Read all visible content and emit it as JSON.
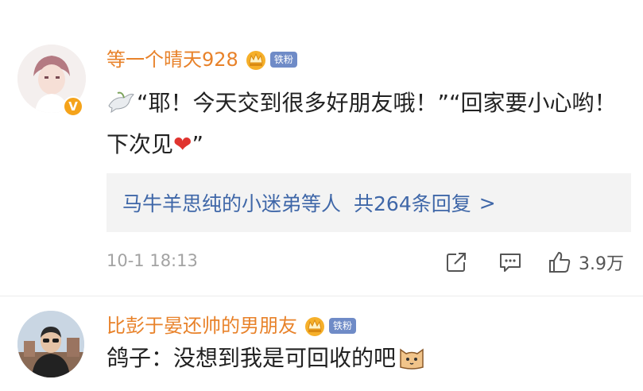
{
  "comments": [
    {
      "username": "等一个晴天928",
      "fan_badge": "铁粉",
      "text_before_heart": "“耶！今天交到很多好朋友哦！”“回家要小心哟！下次见",
      "heart_emoji": "❤",
      "text_after_heart": "”",
      "reply_summary": "马牛羊思纯的小迷弟等人",
      "reply_count": "共264条回复",
      "reply_arrow": ">",
      "time": "10-1 18:13",
      "like_count": "3.9万",
      "verified_badge": "V"
    },
    {
      "username": "比彭于晏还帅的男朋友",
      "fan_badge": "铁粉",
      "text": "鸽子：没想到我是可回收的吧"
    }
  ],
  "colors": {
    "username": "#e8822a",
    "reply_link": "#3f67a8",
    "fan_badge_bg": "#6f8bc7",
    "meta_gray": "#a3a3a3"
  },
  "icons": [
    "dove-emoji-icon",
    "heart-emoji-icon",
    "crown-icon",
    "share-icon",
    "comment-icon",
    "thumbs-up-icon",
    "cat-emoji-icon"
  ]
}
